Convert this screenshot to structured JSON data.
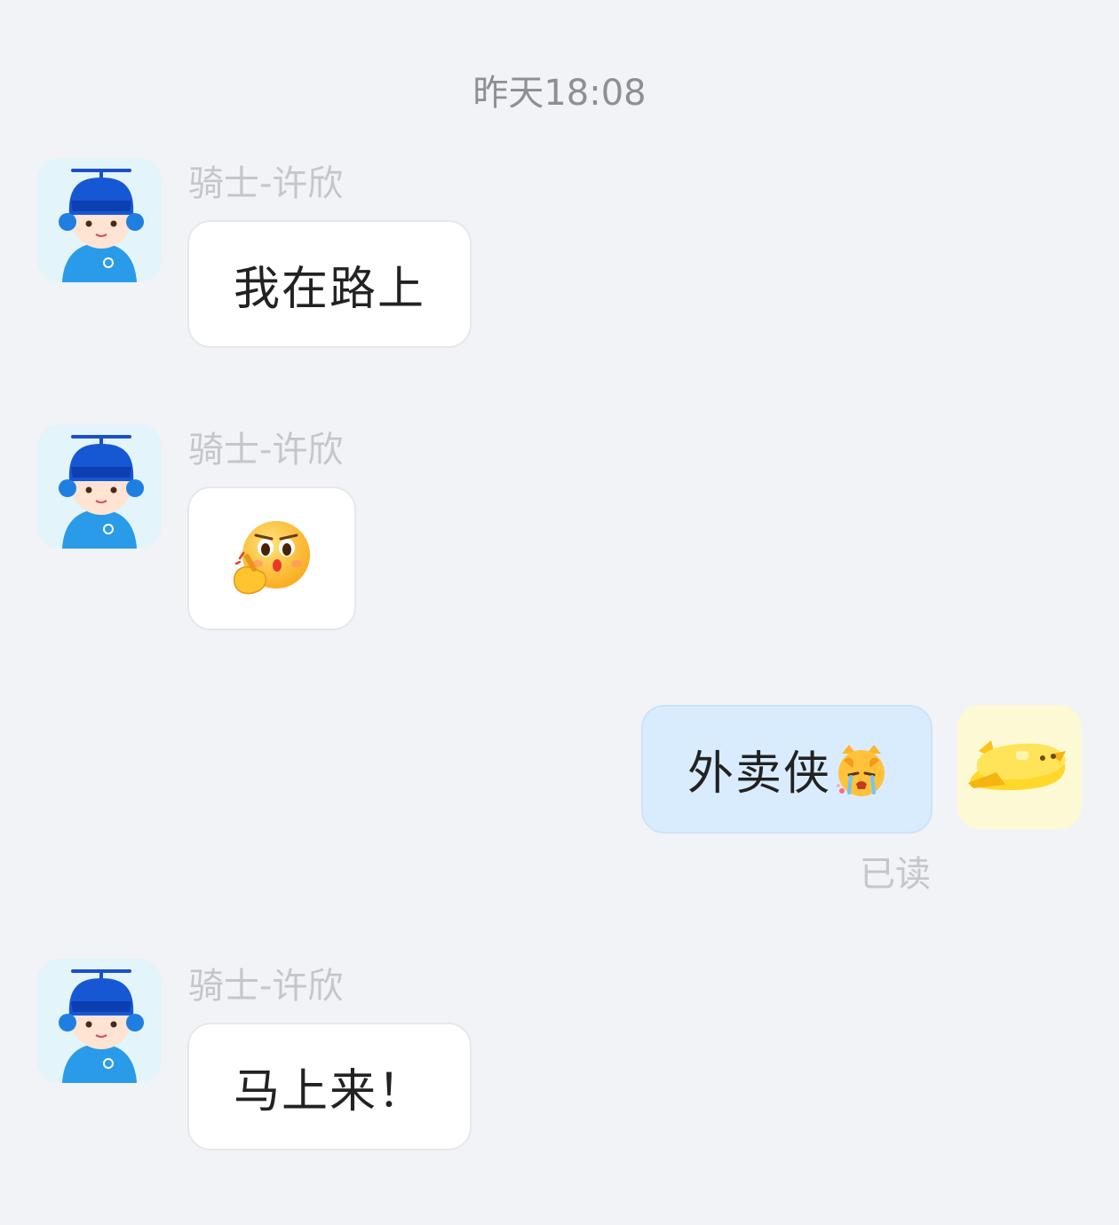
{
  "chat": {
    "timestamp": "昨天18:08",
    "messages": [
      {
        "sender": "骑士-许欣",
        "text": "我在路上"
      },
      {
        "sender": "骑士-许欣",
        "sticker": "pointing-shocked-face-sticker"
      },
      {
        "text": "外卖侠",
        "emoji": "crying-cat-emoji",
        "status": "已读"
      },
      {
        "sender": "骑士-许欣",
        "text": "马上来！"
      }
    ]
  }
}
